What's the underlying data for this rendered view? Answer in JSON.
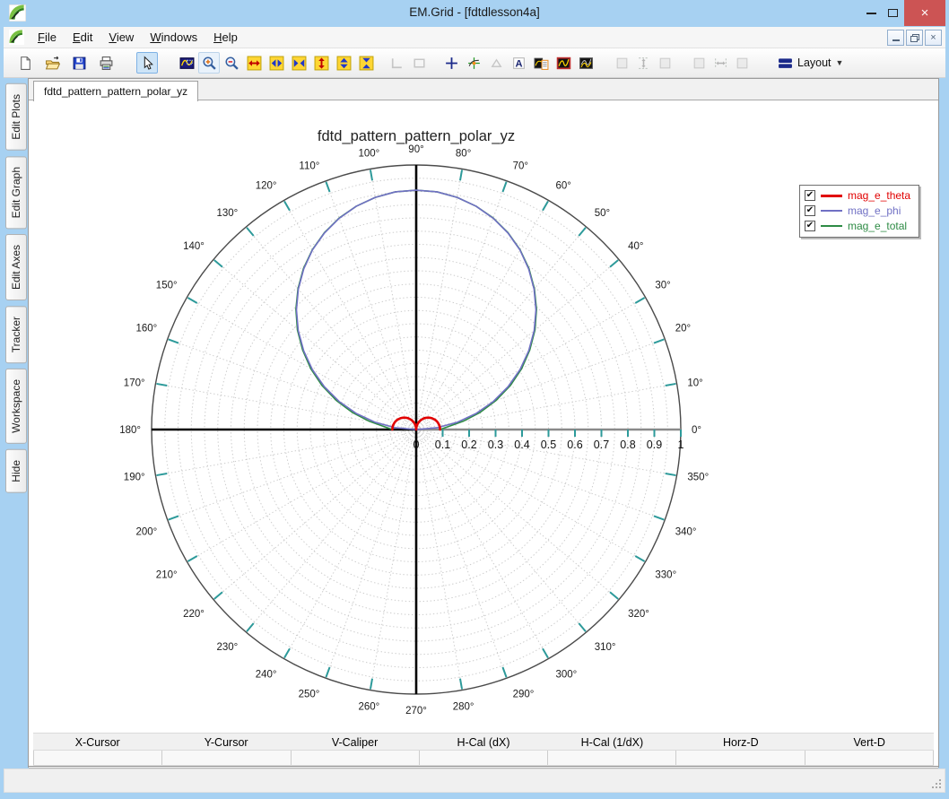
{
  "window": {
    "title": "EM.Grid - [fdtdlesson4a]"
  },
  "menu": {
    "items": [
      "File",
      "Edit",
      "View",
      "Windows",
      "Help"
    ]
  },
  "toolbar": {
    "layout_label": "Layout",
    "buttons": [
      {
        "icon": "new-file-icon",
        "state": "normal"
      },
      {
        "icon": "open-file-icon",
        "state": "normal"
      },
      {
        "icon": "save-icon",
        "state": "normal"
      },
      {
        "icon": "print-icon",
        "state": "normal"
      },
      {
        "icon": "pointer-icon",
        "state": "selected"
      },
      {
        "icon": "zoom-box-icon",
        "state": "normal"
      },
      {
        "icon": "zoom-in-icon",
        "state": "highlight"
      },
      {
        "icon": "zoom-out-icon",
        "state": "normal"
      },
      {
        "icon": "expand-x-icon",
        "state": "normal"
      },
      {
        "icon": "pan-x-icon",
        "state": "normal"
      },
      {
        "icon": "shrink-x-icon",
        "state": "normal"
      },
      {
        "icon": "expand-y-icon",
        "state": "normal"
      },
      {
        "icon": "pan-y-icon",
        "state": "normal"
      },
      {
        "icon": "shrink-y-icon",
        "state": "normal"
      },
      {
        "icon": "axes-corner-icon",
        "state": "disabled"
      },
      {
        "icon": "plot-box-icon",
        "state": "disabled"
      },
      {
        "icon": "crosshair-icon",
        "state": "normal"
      },
      {
        "icon": "tracker-icon",
        "state": "normal"
      },
      {
        "icon": "caliper-icon",
        "state": "disabled"
      },
      {
        "icon": "text-label-icon",
        "state": "normal"
      },
      {
        "icon": "plot-list-icon",
        "state": "normal"
      },
      {
        "icon": "plot-dark-icon",
        "state": "normal"
      },
      {
        "icon": "plots-dark-icon",
        "state": "normal"
      },
      {
        "icon": "subplot-left-icon",
        "state": "disabled"
      },
      {
        "icon": "expand-v-dashed-icon",
        "state": "disabled"
      },
      {
        "icon": "subplot-mid-icon",
        "state": "disabled"
      },
      {
        "icon": "subplot-right-icon",
        "state": "disabled"
      },
      {
        "icon": "expand-h-dashed-icon",
        "state": "disabled"
      },
      {
        "icon": "subplot-end-icon",
        "state": "disabled"
      }
    ]
  },
  "sidebar": {
    "tabs": [
      "Edit Plots",
      "Edit Graph",
      "Edit Axes",
      "Tracker",
      "Workspace",
      "Hide"
    ]
  },
  "document_tab": "fdtd_pattern_pattern_polar_yz",
  "chart_data": {
    "type": "line",
    "polar": true,
    "title": "fdtd_pattern_pattern_polar_yz",
    "rmax": 1,
    "r_tick_step": 0.1,
    "r_grid_step": 0.05,
    "angle_grid_step_deg": 10,
    "angle_labels": [
      "0°",
      "10°",
      "20°",
      "30°",
      "40°",
      "50°",
      "60°",
      "70°",
      "80°",
      "90°",
      "100°",
      "110°",
      "120°",
      "130°",
      "140°",
      "150°",
      "160°",
      "170°",
      "180°",
      "190°",
      "200°",
      "210°",
      "220°",
      "230°",
      "240°",
      "250°",
      "260°",
      "270°",
      "280°",
      "290°",
      "300°",
      "310°",
      "320°",
      "330°",
      "340°",
      "350°"
    ],
    "r_labels": [
      "0",
      "0.1",
      "0.2",
      "0.3",
      "0.4",
      "0.5",
      "0.6",
      "0.7",
      "0.8",
      "0.9",
      "1"
    ],
    "theta_deg": [
      0,
      5,
      10,
      15,
      20,
      25,
      30,
      35,
      40,
      45,
      50,
      55,
      60,
      65,
      70,
      75,
      80,
      85,
      90,
      95,
      100,
      105,
      110,
      115,
      120,
      125,
      130,
      135,
      140,
      145,
      150,
      155,
      160,
      165,
      170,
      175,
      180
    ],
    "series": [
      {
        "name": "mag_e_theta",
        "color": "#e10000",
        "width": 2.6,
        "r": [
          0.09,
          0.09,
          0.089,
          0.087,
          0.085,
          0.082,
          0.078,
          0.074,
          0.069,
          0.064,
          0.058,
          0.052,
          0.045,
          0.038,
          0.031,
          0.023,
          0.016,
          0.008,
          0,
          0.008,
          0.016,
          0.023,
          0.031,
          0.038,
          0.045,
          0.052,
          0.058,
          0.064,
          0.069,
          0.074,
          0.078,
          0.082,
          0.085,
          0.087,
          0.089,
          0.09,
          0.09
        ]
      },
      {
        "name": "mag_e_phi",
        "color": "#7070c4",
        "width": 1.6,
        "r": [
          0,
          0.079,
          0.157,
          0.234,
          0.31,
          0.383,
          0.453,
          0.519,
          0.582,
          0.64,
          0.693,
          0.741,
          0.784,
          0.82,
          0.85,
          0.874,
          0.891,
          0.902,
          0.905,
          0.902,
          0.891,
          0.874,
          0.85,
          0.82,
          0.784,
          0.741,
          0.693,
          0.64,
          0.582,
          0.519,
          0.453,
          0.383,
          0.31,
          0.234,
          0.157,
          0.079,
          0
        ]
      },
      {
        "name": "mag_e_total",
        "color": "#2e8b45",
        "width": 1.6,
        "r": [
          0.09,
          0.12,
          0.18,
          0.25,
          0.321,
          0.392,
          0.46,
          0.524,
          0.586,
          0.643,
          0.695,
          0.743,
          0.785,
          0.821,
          0.851,
          0.874,
          0.891,
          0.902,
          0.905,
          0.902,
          0.891,
          0.874,
          0.851,
          0.821,
          0.785,
          0.743,
          0.695,
          0.643,
          0.586,
          0.524,
          0.46,
          0.392,
          0.321,
          0.25,
          0.18,
          0.12,
          0.09
        ]
      }
    ],
    "grid_color": "#cccccc",
    "tick_color": "#2d9a9a",
    "rim_color": "#4b4b4b"
  },
  "legend": {
    "items": [
      {
        "label": "mag_e_theta",
        "color": "#e10000",
        "checked": true
      },
      {
        "label": "mag_e_phi",
        "color": "#7070c4",
        "checked": true
      },
      {
        "label": "mag_e_total",
        "color": "#2e8b45",
        "checked": true
      }
    ]
  },
  "cursor_table": {
    "columns": [
      "X-Cursor",
      "Y-Cursor",
      "V-Caliper",
      "H-Cal (dX)",
      "H-Cal (1/dX)",
      "Horz-D",
      "Vert-D"
    ],
    "row": [
      "",
      "",
      "",
      "",
      "",
      "",
      ""
    ]
  }
}
